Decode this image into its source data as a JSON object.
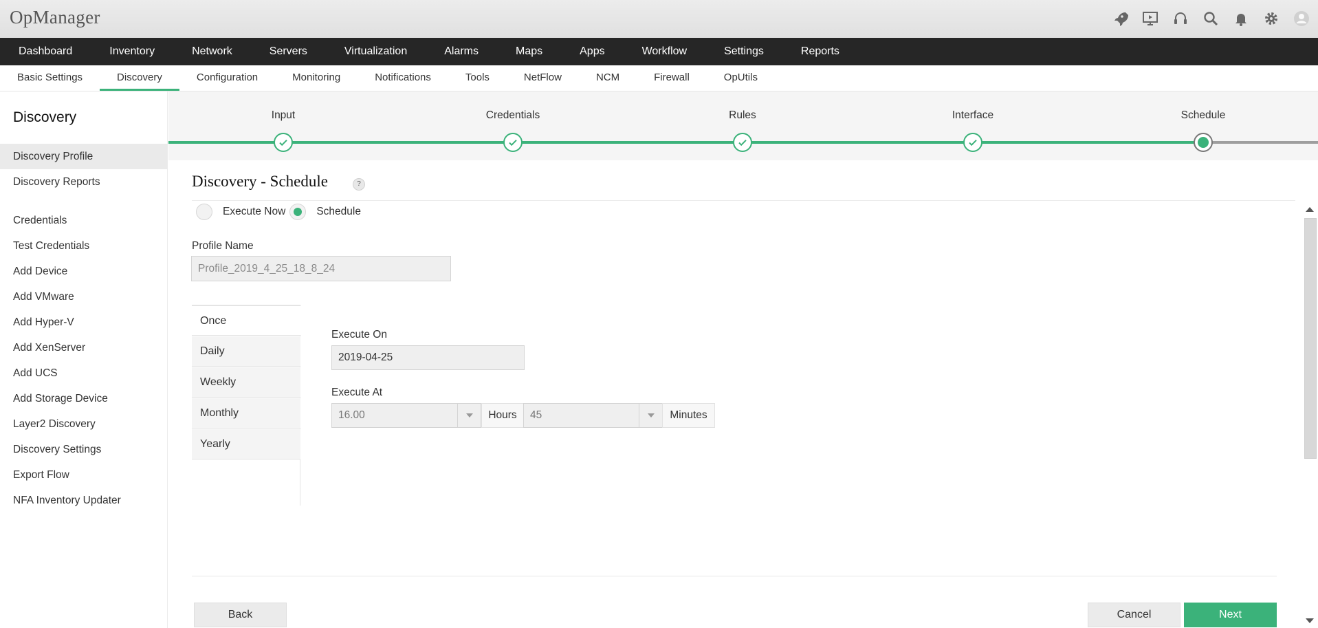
{
  "app": {
    "title": "OpManager"
  },
  "header_icons": [
    "rocket-icon",
    "presentation-icon",
    "headset-icon",
    "search-icon",
    "bell-icon",
    "gear-icon",
    "user-avatar-icon"
  ],
  "main_nav": [
    "Dashboard",
    "Inventory",
    "Network",
    "Servers",
    "Virtualization",
    "Alarms",
    "Maps",
    "Apps",
    "Workflow",
    "Settings",
    "Reports"
  ],
  "sub_nav": {
    "items": [
      "Basic Settings",
      "Discovery",
      "Configuration",
      "Monitoring",
      "Notifications",
      "Tools",
      "NetFlow",
      "NCM",
      "Firewall",
      "OpUtils"
    ],
    "active": "Discovery"
  },
  "sidebar": {
    "title": "Discovery",
    "items": [
      "Discovery Profile",
      "Discovery Reports",
      "Credentials",
      "Test Credentials",
      "Add Device",
      "Add VMware",
      "Add Hyper-V",
      "Add XenServer",
      "Add UCS",
      "Add Storage Device",
      "Layer2 Discovery",
      "Discovery Settings",
      "Export Flow",
      "NFA Inventory Updater"
    ],
    "active": "Discovery Profile"
  },
  "wizard": {
    "steps": [
      "Input",
      "Credentials",
      "Rules",
      "Interface",
      "Schedule"
    ],
    "current": "Schedule",
    "colors": {
      "complete": "#3bb27a",
      "pending": "#9e9e9e"
    }
  },
  "form": {
    "title": "Discovery - Schedule",
    "help": "?",
    "execute_now_label": "Execute Now",
    "schedule_label": "Schedule",
    "selected_mode": "Schedule",
    "profile_name_label": "Profile Name",
    "profile_name_value": "Profile_2019_4_25_18_8_24",
    "frequency_tabs": [
      "Once",
      "Daily",
      "Weekly",
      "Monthly",
      "Yearly"
    ],
    "frequency_active": "Once",
    "execute_on_label": "Execute On",
    "execute_on_value": "2019-04-25",
    "execute_at_label": "Execute At",
    "hours_value": "16.00",
    "hours_label": "Hours",
    "minutes_value": "45",
    "minutes_label": "Minutes"
  },
  "buttons": {
    "back": "Back",
    "cancel": "Cancel",
    "next": "Next"
  },
  "colors": {
    "accent": "#3bb27a",
    "nav_bg": "#262626"
  }
}
